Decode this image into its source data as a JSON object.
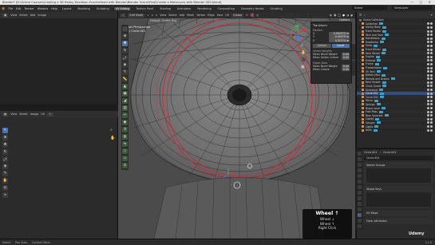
{
  "window": {
    "title": "Blender* [D:\\Online Courses\\Creating a 3D Harley Davidson Knucklehead with Blender\\Blender Scene\\Final\\Create a Motorcycle with Blender 3D2.blend]",
    "controls": "— ▢ ✕"
  },
  "menu": {
    "items": [
      "File",
      "Edit",
      "Render",
      "Window",
      "Help"
    ],
    "workspaces": [
      "Layout",
      "Modeling",
      "Sculpting",
      "UV Editing",
      "Texture Paint",
      "Shading",
      "Animation",
      "Rendering",
      "Compositing",
      "Geometry Nodes",
      "Scripting"
    ],
    "active_workspace": "UV Editing",
    "scene": "Scene",
    "view_layer": "ViewLayer"
  },
  "uv_editor": {
    "header_items": [
      "View",
      "Select",
      "Add",
      "Image"
    ],
    "mode": "UV Vertex",
    "header_bottom": [
      "View",
      "Select",
      "Image",
      "UV"
    ],
    "tools": [
      "select",
      "cursor",
      "move",
      "rotate",
      "scale",
      "transform",
      "annotate",
      "grab",
      "pinch",
      "relax"
    ]
  },
  "viewport": {
    "mode": "Edit Mode",
    "header_items": [
      "View",
      "Select",
      "Add",
      "Mesh",
      "Vertex",
      "Edge",
      "Face",
      "UV"
    ],
    "orientation": "Global",
    "pivot": "Default",
    "drag": "Select Box",
    "view_name": "User Perspective",
    "object_name": "(2) Circle.001",
    "options_label": "Options"
  },
  "npanel": {
    "title": "Transform",
    "median_label": "Median:",
    "rows": [
      {
        "label": "X",
        "value": "0.002975 m"
      },
      {
        "label": "Y",
        "value": "-0.00079 m"
      },
      {
        "label": "Z",
        "value": "0.02374 m"
      }
    ],
    "buttons": [
      "Global",
      "Local"
    ],
    "active_button": "Local",
    "vertex_weights_label": "Vertex Weights",
    "mean_bevel_weight": {
      "label": "Mean Bevel Weight",
      "value": "0.00"
    },
    "mean_vertex_crease": {
      "label": "Mean Vertex Crease",
      "value": "0.00"
    },
    "edges_label": "Edges Data",
    "mean_bevel_weight_e": {
      "label": "Mean Bevel Weight",
      "value": "0.00"
    },
    "mean_crease": {
      "label": "Mean Crease",
      "value": "0.00"
    }
  },
  "outliner": {
    "header": "Scene Collection",
    "rows": [
      "Collection",
      "Harley Body",
      "Front Fender",
      "Tank and Seat",
      "Handlebars",
      "Headlamp",
      "Forks",
      "Front Wheel",
      "Rear Wheel",
      "Engine",
      "Exhaust",
      "Frame",
      "Transmission",
      "Oil Tank",
      "Battery Box",
      "Wheels and Brakes",
      "Rear Fender",
      "Chain Guard",
      "Kickstand",
      "Circle.001",
      "Circle.002",
      "Mirror",
      "Springs",
      "Brake Lever",
      "Foot Pegs",
      "Rear Sprocket",
      "Cables",
      "Gauges",
      "Lights",
      "Bolts"
    ],
    "selected": "Circle.001"
  },
  "properties": {
    "object_name": "Circle.001",
    "mesh_name": "Circle.001",
    "search_placeholder": "",
    "panels": [
      "Vertex Groups",
      "Shape Keys",
      "UV Maps",
      "Color Attributes"
    ]
  },
  "overlay": {
    "title": "Wheel ↑",
    "lines": [
      "Wheel ↓",
      "Wheel ↑",
      "Right Click"
    ]
  },
  "status": {
    "items": [
      "Select",
      "Pan View",
      "Context Menu"
    ],
    "right": "3.1.0"
  },
  "watermark": "Udemy",
  "colors": {
    "accent": "#4772b3",
    "selection_red": "#d0283a",
    "mesh_wire": "#1a1a1a"
  }
}
